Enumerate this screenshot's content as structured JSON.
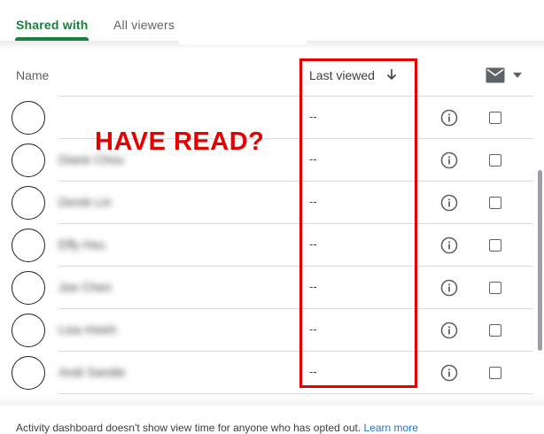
{
  "tabs": {
    "shared_with": "Shared with",
    "all_viewers": "All viewers"
  },
  "table": {
    "col_name": "Name",
    "col_last_viewed": "Last viewed",
    "rows": [
      {
        "name": "",
        "viewed": "--"
      },
      {
        "name": "Diane Chou",
        "viewed": "--"
      },
      {
        "name": "Derek Lin",
        "viewed": "--"
      },
      {
        "name": "Effy Hsu",
        "viewed": "--"
      },
      {
        "name": "Joe Chen",
        "viewed": "--"
      },
      {
        "name": "Lisa Hsieh",
        "viewed": "--"
      },
      {
        "name": "Andi Sandie",
        "viewed": "--"
      }
    ]
  },
  "annotation": {
    "text": "HAVE READ?"
  },
  "footer": {
    "text": "Activity dashboard doesn't show view time for anyone who has opted out.",
    "link": "Learn more"
  },
  "icons": {
    "sort": "arrow-down-icon",
    "mail": "mail-icon",
    "dropdown": "caret-down-icon",
    "info": "info-icon",
    "checkbox": "checkbox-icon"
  },
  "colors": {
    "accent_green": "#188038",
    "annotation_red": "#e60000",
    "link_blue": "#1a73e8"
  }
}
